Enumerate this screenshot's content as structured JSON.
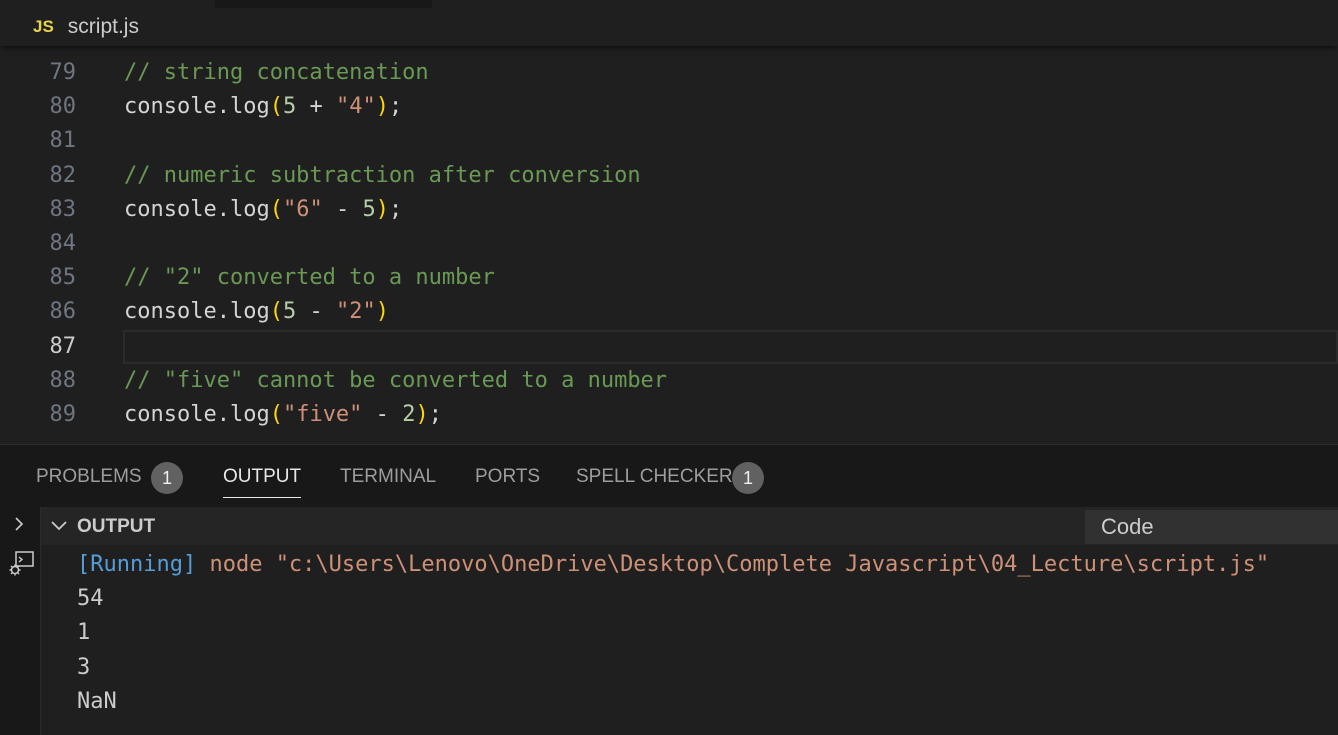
{
  "tab": {
    "icon_text": "JS",
    "file_name": "script.js"
  },
  "editor": {
    "current_line": "87",
    "lines": [
      {
        "number": "79",
        "tokens": [
          {
            "t": "comment",
            "v": "// string concatenation"
          }
        ]
      },
      {
        "number": "80",
        "tokens": [
          {
            "t": "plain",
            "v": "console.log"
          },
          {
            "t": "paren",
            "v": "("
          },
          {
            "t": "number",
            "v": "5"
          },
          {
            "t": "plain",
            "v": " + "
          },
          {
            "t": "string",
            "v": "\"4\""
          },
          {
            "t": "paren",
            "v": ")"
          },
          {
            "t": "plain",
            "v": ";"
          }
        ]
      },
      {
        "number": "81",
        "tokens": []
      },
      {
        "number": "82",
        "tokens": [
          {
            "t": "comment",
            "v": "// numeric subtraction after conversion"
          }
        ]
      },
      {
        "number": "83",
        "tokens": [
          {
            "t": "plain",
            "v": "console.log"
          },
          {
            "t": "paren",
            "v": "("
          },
          {
            "t": "string",
            "v": "\"6\""
          },
          {
            "t": "plain",
            "v": " - "
          },
          {
            "t": "number",
            "v": "5"
          },
          {
            "t": "paren",
            "v": ")"
          },
          {
            "t": "plain",
            "v": ";"
          }
        ]
      },
      {
        "number": "84",
        "tokens": []
      },
      {
        "number": "85",
        "tokens": [
          {
            "t": "comment",
            "v": "// \"2\" converted to a number"
          }
        ]
      },
      {
        "number": "86",
        "tokens": [
          {
            "t": "plain",
            "v": "console.log"
          },
          {
            "t": "paren",
            "v": "("
          },
          {
            "t": "number",
            "v": "5"
          },
          {
            "t": "plain",
            "v": " - "
          },
          {
            "t": "string",
            "v": "\"2\""
          },
          {
            "t": "paren",
            "v": ")"
          }
        ]
      },
      {
        "number": "87",
        "tokens": []
      },
      {
        "number": "88",
        "tokens": [
          {
            "t": "comment",
            "v": "// \"five\" cannot be converted to a number"
          }
        ]
      },
      {
        "number": "89",
        "tokens": [
          {
            "t": "plain",
            "v": "console.log"
          },
          {
            "t": "paren",
            "v": "("
          },
          {
            "t": "string",
            "v": "\"five\""
          },
          {
            "t": "plain",
            "v": " - "
          },
          {
            "t": "number",
            "v": "2"
          },
          {
            "t": "paren",
            "v": ")"
          },
          {
            "t": "plain",
            "v": ";"
          }
        ]
      }
    ]
  },
  "panel": {
    "tabs": [
      {
        "label": "PROBLEMS",
        "badge": "1"
      },
      {
        "label": "OUTPUT",
        "active": true
      },
      {
        "label": "TERMINAL"
      },
      {
        "label": "PORTS"
      },
      {
        "label": "SPELL CHECKER",
        "badge": "1"
      }
    ],
    "output_title": "OUTPUT",
    "channel_select": "Code",
    "output": {
      "running_tag": "[Running]",
      "command": " node \"c:\\Users\\Lenovo\\OneDrive\\Desktop\\Complete Javascript\\04_Lecture\\script.js\"",
      "results": [
        "54",
        "1",
        "3",
        "NaN"
      ]
    }
  },
  "icons": {
    "sidebar_toggle": "chevron-right-icon",
    "output_view": "output-terminal-icon",
    "collapse": "chevron-down-icon"
  },
  "colors": {
    "comment": "#6a9955",
    "string": "#ce9178",
    "number": "#b5cea8",
    "bracket": "#ffd700",
    "running": "#569cd6",
    "js_icon": "#e8d44d"
  }
}
